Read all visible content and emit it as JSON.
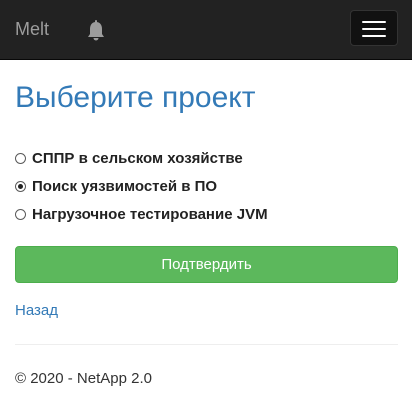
{
  "navbar": {
    "brand": "Melt",
    "notification_icon": "bell-icon",
    "menu_icon": "hamburger-menu-icon",
    "background": "#222222"
  },
  "main": {
    "title": "Выберите проект",
    "projects": [
      {
        "label": "СППР в сельском хозяйстве",
        "selected": false
      },
      {
        "label": "Поиск уязвимостей в ПО",
        "selected": true
      },
      {
        "label": "Нагрузочное тестирование JVM",
        "selected": false
      }
    ],
    "submit_label": "Подтвердить",
    "back_label": "Назад"
  },
  "footer": {
    "text": "© 2020 - NetApp 2.0"
  },
  "colors": {
    "accent": "#337ab7",
    "success": "#5cb85c"
  }
}
